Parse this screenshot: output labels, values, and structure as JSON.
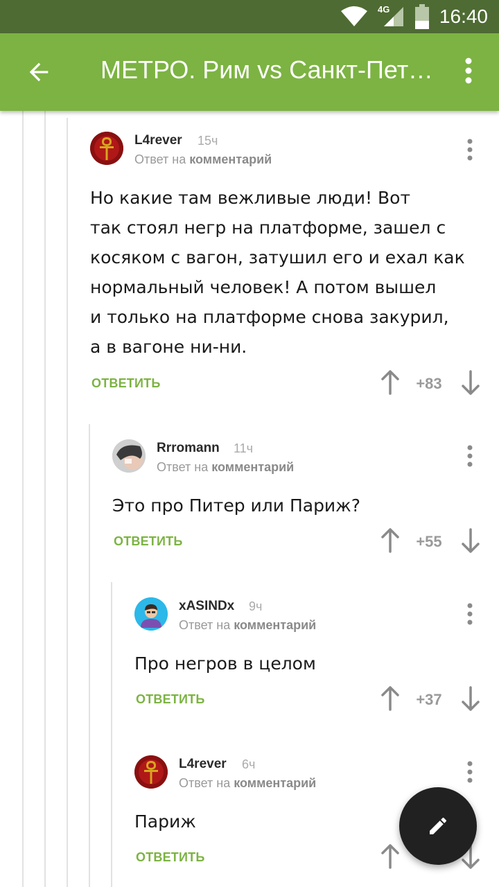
{
  "status_bar": {
    "time": "16:40",
    "network": "4G",
    "icons": [
      "wifi-icon",
      "signal-icon",
      "battery-icon"
    ]
  },
  "app_bar": {
    "title": "МЕТРО. Рим vs Санкт-Петербург",
    "back_icon": "arrow-back-icon",
    "menu_icon": "more-vert-icon"
  },
  "colors": {
    "status_bar": "#4e6b33",
    "app_bar": "#7cb342",
    "accent": "#7cb342",
    "fab": "#212121"
  },
  "comments": [
    {
      "author": "L4rever",
      "time": "15ч",
      "reply_prefix": "Ответ на",
      "reply_target": "комментарий",
      "text_lines": [
        "Но какие там вежливые люди! Вот",
        "так стоял негр на платформе, зашел с",
        "косяком с вагон, затушил его и ехал как",
        "нормальный человек! А потом вышел",
        "и только на платформе снова закурил,",
        "а в вагоне ни-ни."
      ],
      "reply_label": "ОТВЕТИТЬ",
      "score": "+83"
    },
    {
      "author": "Rrromann",
      "time": "11ч",
      "reply_prefix": "Ответ на",
      "reply_target": "комментарий",
      "text_lines": [
        "Это про Питер или Париж?"
      ],
      "reply_label": "ОТВЕТИТЬ",
      "score": "+55"
    },
    {
      "author": "xASINDx",
      "time": "9ч",
      "reply_prefix": "Ответ на",
      "reply_target": "комментарий",
      "text_lines": [
        "Про негров в целом"
      ],
      "reply_label": "ОТВЕТИТЬ",
      "score": "+37"
    },
    {
      "author": "L4rever",
      "time": "6ч",
      "reply_prefix": "Ответ на",
      "reply_target": "комментарий",
      "text_lines": [
        "Париж"
      ],
      "reply_label": "ОТВЕТИТЬ",
      "score": ""
    }
  ],
  "fab": {
    "icon": "pencil-icon"
  }
}
